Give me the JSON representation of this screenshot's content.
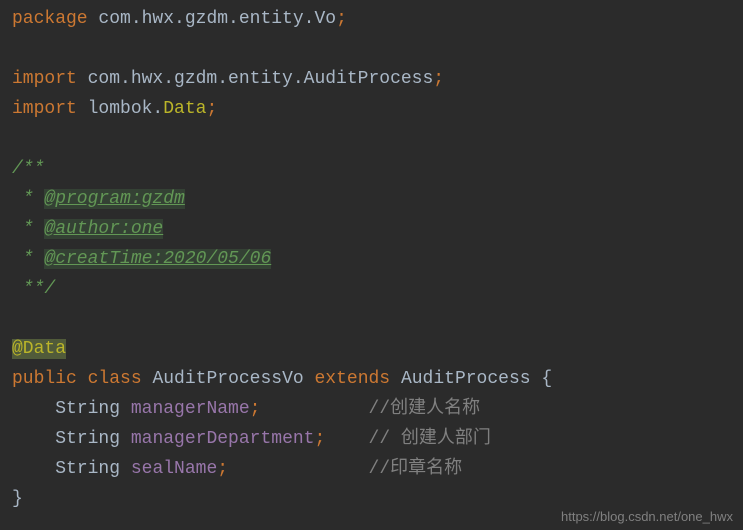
{
  "code": {
    "line1": {
      "kw": "package",
      "pkg": " com.hwx.gzdm.entity.Vo",
      "semi": ";"
    },
    "line3": {
      "kw": "import",
      "pkg": " com.hwx.gzdm.entity.AuditProcess",
      "semi": ";"
    },
    "line4": {
      "kw": "import",
      "pkg1": " lombok.",
      "data": "Data",
      "semi": ";"
    },
    "line6": {
      "txt": "/**"
    },
    "line7": {
      "prefix": " * ",
      "tag": "@program:gzdm"
    },
    "line8": {
      "prefix": " * ",
      "tag": "@author:one"
    },
    "line9": {
      "prefix": " * ",
      "tag": "@creatTime:2020/05/06"
    },
    "line10": {
      "txt": " **/"
    },
    "line12": {
      "anno": "@Data"
    },
    "line13": {
      "kw1": "public",
      "kw2": "class",
      "name": "AuditProcessVo",
      "kw3": "extends",
      "parent": "AuditProcess",
      "brace": "{"
    },
    "line14": {
      "indent": "    ",
      "type": "String",
      "field": "managerName",
      "semi": ";",
      "pad": "          ",
      "comment": "//创建人名称"
    },
    "line15": {
      "indent": "    ",
      "type": "String",
      "field": "managerDepartment",
      "semi": ";",
      "pad": "    ",
      "comment": "// 创建人部门"
    },
    "line16": {
      "indent": "    ",
      "type": "String",
      "field": "sealName",
      "semi": ";",
      "pad": "             ",
      "comment": "//印章名称"
    },
    "line17": {
      "brace": "}"
    }
  },
  "watermark": "https://blog.csdn.net/one_hwx"
}
